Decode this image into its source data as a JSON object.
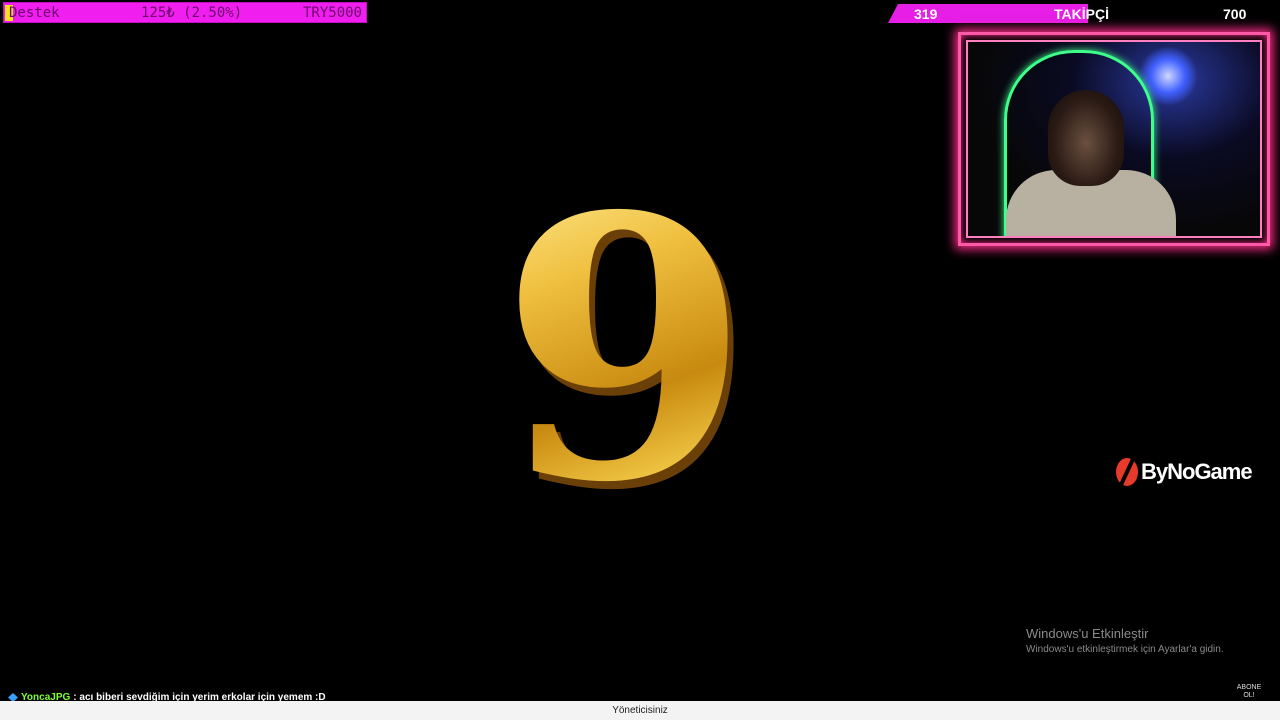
{
  "donation": {
    "label": "Destek",
    "progress": "125₺ (2.50%)",
    "goal": "TRY5000",
    "fill_fraction": 0.025
  },
  "followers": {
    "current": "319",
    "label": "TAKİPÇİ",
    "goal": "700"
  },
  "countdown": {
    "value": "9"
  },
  "logo": {
    "text": "ByNoGame"
  },
  "windows_activation": {
    "title": "Windows'u Etkinleştir",
    "subtitle": "Windows'u etkinleştirmek için Ayarlar'a gidin."
  },
  "chat": {
    "username": "YoncaJPG",
    "message": ": acı biberi sevdiğim için yerim erkolar için yemem :D"
  },
  "subscribe": {
    "label": "ABONE OL!"
  },
  "footer": {
    "text": "Yöneticisiniz"
  },
  "colors": {
    "donation_bar": "#f01ff0",
    "follower_bar": "#e61ee6",
    "webcam_border": "#ff5aa8",
    "countdown_gold": "#d8a02a",
    "chat_user": "#7cff3a"
  }
}
